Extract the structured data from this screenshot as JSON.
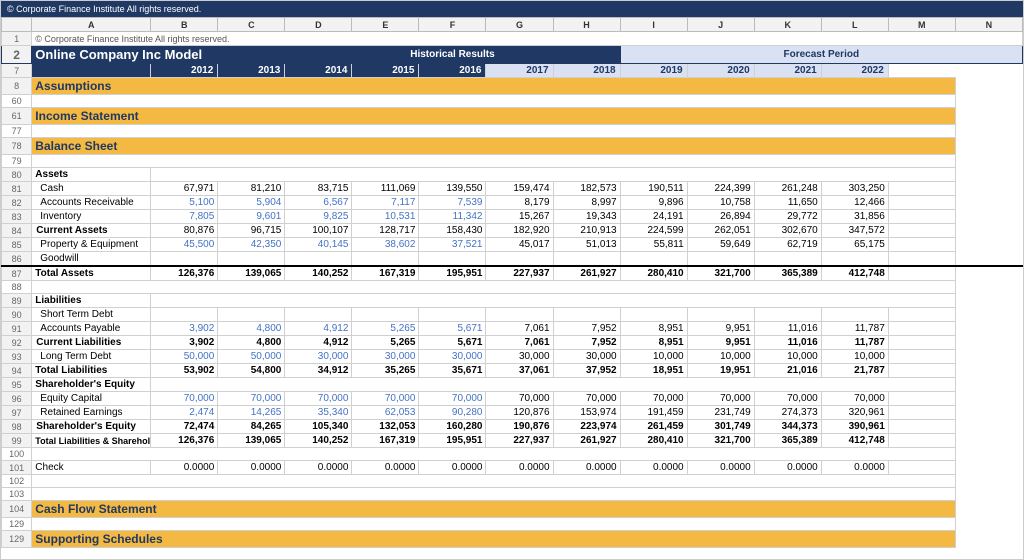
{
  "topBar": "© Corporate Finance Institute  All rights reserved.",
  "title": "Online Company Inc Model",
  "columns": {
    "rowNums": [
      "",
      "1",
      "2",
      "7",
      "8",
      "60",
      "61",
      "77",
      "78",
      "79",
      "80",
      "81",
      "82",
      "83",
      "84",
      "85",
      "86",
      "87",
      "88",
      "89",
      "90",
      "91",
      "92",
      "93",
      "94",
      "95",
      "96",
      "97",
      "98",
      "99",
      "100",
      "101",
      "102",
      "103",
      "104",
      "129"
    ],
    "letters": [
      "",
      "A",
      "B",
      "C",
      "D",
      "E",
      "F",
      "G",
      "H",
      "I",
      "J",
      "K",
      "L",
      "M",
      "N"
    ]
  },
  "historicalLabel": "Historical Results",
  "forecastLabel": "Forecast Period",
  "years": {
    "historical": [
      "2012",
      "2013",
      "2014",
      "2015",
      "2016"
    ],
    "forecast": [
      "2017",
      "2018",
      "2019",
      "2020",
      "2021",
      "2022"
    ]
  },
  "sections": {
    "assumptions": "Assumptions",
    "incomeStatement": "Income Statement",
    "balanceSheet": "Balance Sheet",
    "cashFlow": "Cash Flow Statement",
    "supporting": "Supporting Schedules"
  },
  "balanceSheet": {
    "assets": {
      "label": "Assets",
      "rows": [
        {
          "name": "Cash",
          "values": [
            "67,971",
            "81,210",
            "83,715",
            "111,069",
            "139,550",
            "159,474",
            "182,573",
            "190,511",
            "224,399",
            "261,248",
            "303,250"
          ],
          "blue": [
            false,
            false,
            false,
            false,
            false,
            false,
            false,
            false,
            false,
            false,
            false
          ]
        },
        {
          "name": "Accounts Receivable",
          "values": [
            "5,100",
            "5,904",
            "6,567",
            "7,117",
            "7,539",
            "8,179",
            "8,997",
            "9,896",
            "10,758",
            "11,650",
            "12,466"
          ],
          "blue": [
            true,
            true,
            true,
            true,
            true,
            false,
            false,
            false,
            false,
            false,
            false
          ]
        },
        {
          "name": "Inventory",
          "values": [
            "7,805",
            "9,601",
            "9,825",
            "10,531",
            "11,342",
            "15,267",
            "19,343",
            "24,191",
            "26,894",
            "29,772",
            "31,856"
          ],
          "blue": [
            true,
            true,
            true,
            true,
            true,
            false,
            false,
            false,
            false,
            false,
            false
          ]
        },
        {
          "name": "Current Assets",
          "values": [
            "80,876",
            "96,715",
            "100,107",
            "128,717",
            "158,430",
            "182,920",
            "210,913",
            "224,599",
            "262,051",
            "302,670",
            "347,572"
          ],
          "bold": true,
          "blue": [
            false,
            false,
            false,
            false,
            false,
            false,
            false,
            false,
            false,
            false,
            false
          ]
        },
        {
          "name": "Property & Equipment",
          "values": [
            "45,500",
            "42,350",
            "40,145",
            "38,602",
            "37,521",
            "45,017",
            "51,013",
            "55,811",
            "59,649",
            "62,719",
            "65,175"
          ],
          "blue": [
            true,
            true,
            true,
            true,
            true,
            false,
            false,
            false,
            false,
            false,
            false
          ]
        },
        {
          "name": "Goodwill",
          "values": [
            "",
            "",
            "",
            "",
            "",
            "",
            "",
            "",
            "",
            "",
            ""
          ],
          "blue": [
            false,
            false,
            false,
            false,
            false,
            false,
            false,
            false,
            false,
            false,
            false
          ]
        },
        {
          "name": "Total Assets",
          "values": [
            "126,376",
            "139,065",
            "140,252",
            "167,319",
            "195,951",
            "227,937",
            "261,927",
            "280,410",
            "321,700",
            "365,389",
            "412,748"
          ],
          "bold": true,
          "total": true,
          "blue": [
            false,
            false,
            false,
            false,
            false,
            false,
            false,
            false,
            false,
            false,
            false
          ]
        }
      ]
    },
    "liabilities": {
      "label": "Liabilities",
      "rows": [
        {
          "name": "Short Term Debt",
          "values": [
            "",
            "",
            "",
            "",
            "",
            "",
            "",
            "",
            "",
            "",
            ""
          ],
          "blue": [
            false,
            false,
            false,
            false,
            false,
            false,
            false,
            false,
            false,
            false,
            false
          ]
        },
        {
          "name": "Accounts Payable",
          "values": [
            "3,902",
            "4,800",
            "4,912",
            "5,265",
            "5,671",
            "7,061",
            "7,952",
            "8,951",
            "9,951",
            "11,016",
            "11,787"
          ],
          "blue": [
            true,
            true,
            true,
            true,
            true,
            false,
            false,
            false,
            false,
            false,
            false
          ]
        },
        {
          "name": "Current Liabilities",
          "values": [
            "3,902",
            "4,800",
            "4,912",
            "5,265",
            "5,671",
            "7,061",
            "7,952",
            "8,951",
            "9,951",
            "11,016",
            "11,787"
          ],
          "bold": true,
          "blue": [
            false,
            false,
            false,
            false,
            false,
            false,
            false,
            false,
            false,
            false,
            false
          ]
        },
        {
          "name": "Long Term Debt",
          "values": [
            "50,000",
            "50,000",
            "30,000",
            "30,000",
            "30,000",
            "30,000",
            "30,000",
            "10,000",
            "10,000",
            "10,000",
            "10,000"
          ],
          "blue": [
            true,
            true,
            true,
            true,
            true,
            false,
            false,
            false,
            false,
            false,
            false
          ]
        },
        {
          "name": "Total Liabilities",
          "values": [
            "53,902",
            "54,800",
            "34,912",
            "35,265",
            "35,671",
            "37,061",
            "37,952",
            "18,951",
            "19,951",
            "21,016",
            "21,787"
          ],
          "bold": true,
          "total": true,
          "blue": [
            false,
            false,
            false,
            false,
            false,
            false,
            false,
            false,
            false,
            false,
            false
          ]
        }
      ]
    },
    "equity": {
      "label": "Shareholder's Equity",
      "rows": [
        {
          "name": "Equity Capital",
          "values": [
            "70,000",
            "70,000",
            "70,000",
            "70,000",
            "70,000",
            "70,000",
            "70,000",
            "70,000",
            "70,000",
            "70,000",
            "70,000"
          ],
          "blue": [
            true,
            true,
            true,
            true,
            true,
            false,
            false,
            false,
            false,
            false,
            false
          ]
        },
        {
          "name": "Retained Earnings",
          "values": [
            "2,474",
            "14,265",
            "35,340",
            "62,053",
            "90,280",
            "120,876",
            "153,974",
            "191,459",
            "231,749",
            "274,373",
            "320,961"
          ],
          "blue": [
            true,
            true,
            true,
            true,
            true,
            false,
            false,
            false,
            false,
            false,
            false
          ]
        },
        {
          "name": "Shareholder's Equity",
          "values": [
            "72,474",
            "84,265",
            "105,340",
            "132,053",
            "160,280",
            "190,876",
            "223,974",
            "261,459",
            "301,749",
            "344,373",
            "390,961"
          ],
          "bold": true,
          "blue": [
            false,
            false,
            false,
            false,
            false,
            false,
            false,
            false,
            false,
            false,
            false
          ]
        },
        {
          "name": "Total Liabilities & Shareholder's Equity",
          "values": [
            "126,376",
            "139,065",
            "140,252",
            "167,319",
            "195,951",
            "227,937",
            "261,927",
            "280,410",
            "321,700",
            "365,389",
            "412,748"
          ],
          "bold": true,
          "total": true,
          "blue": [
            false,
            false,
            false,
            false,
            false,
            false,
            false,
            false,
            false,
            false,
            false
          ]
        }
      ]
    },
    "check": {
      "label": "Check",
      "values": [
        "0.0000",
        "0.0000",
        "0.0000",
        "0.0000",
        "0.0000",
        "0.0000",
        "0.0000",
        "0.0000",
        "0.0000",
        "0.0000",
        "0.0000"
      ]
    }
  },
  "colors": {
    "darkBlue": "#1f3864",
    "orange": "#f4b942",
    "lightBlue": "#4472c4",
    "forecastBg": "#d9e1f2"
  }
}
